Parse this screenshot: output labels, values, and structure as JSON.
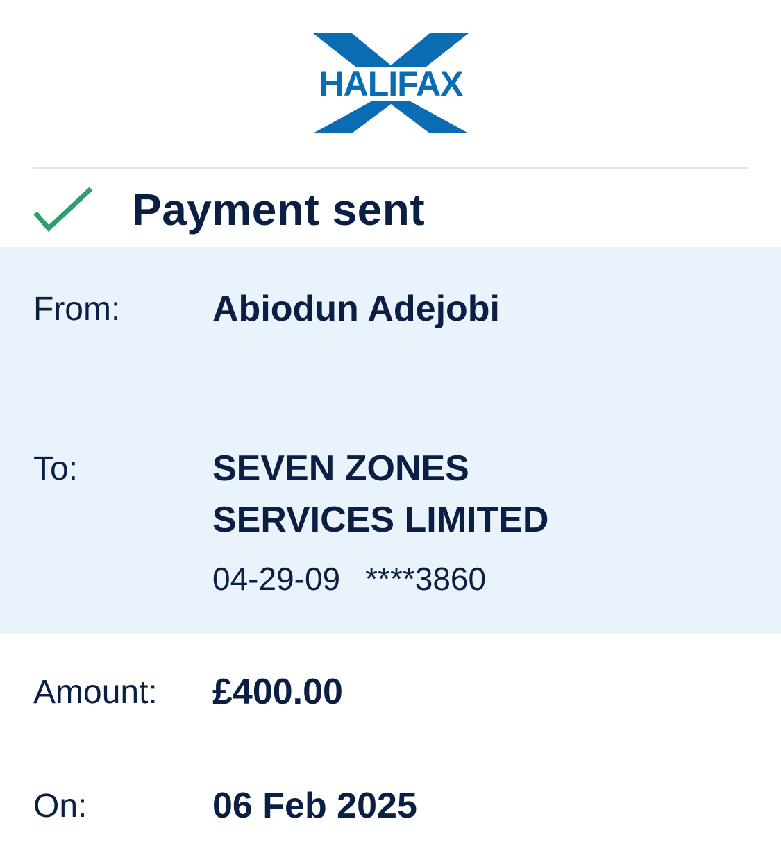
{
  "logo": {
    "text": "HALIFAX",
    "colors": {
      "primary": "#0a6cb3",
      "white": "#ffffff"
    }
  },
  "status": {
    "icon": "check-icon",
    "icon_color": "#2e9e6a",
    "title": "Payment sent"
  },
  "details": {
    "from": {
      "label": "From:",
      "value": "Abiodun Adejobi"
    },
    "to": {
      "label": "To:",
      "name_line1": "SEVEN ZONES",
      "name_line2": "SERVICES LIMITED",
      "sort_code": "04-29-09",
      "account": "****3860"
    },
    "amount": {
      "label": "Amount:",
      "value": "£400.00"
    },
    "on": {
      "label": "On:",
      "value": "06 Feb 2025"
    }
  },
  "colors": {
    "text": "#0b1f44",
    "highlight_bg": "#eaf3fc",
    "divider": "#e2e4ea"
  }
}
